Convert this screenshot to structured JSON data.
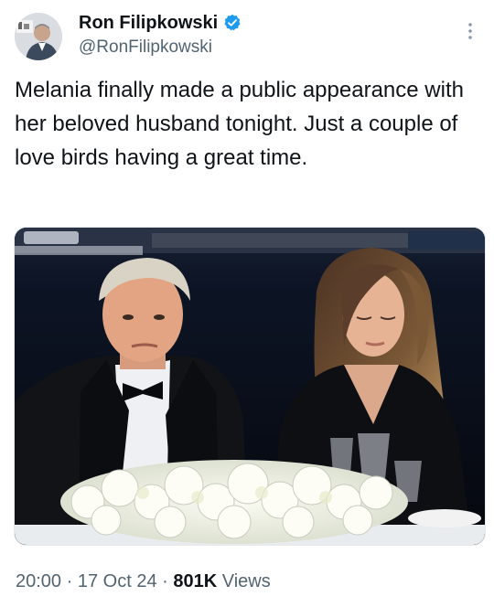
{
  "author": {
    "name": "Ron Filipkowski",
    "handle": "@RonFilipkowski",
    "verified": true,
    "verified_color": "#1d9bf0",
    "avatar_icon": "avatar-photo"
  },
  "tweet": {
    "text": "Melania finally made a public appearance with her beloved husband tonight. Just a couple of love birds having a great time.",
    "media": {
      "type": "photo",
      "icon": "photo"
    }
  },
  "meta": {
    "time": "20:00",
    "sep1": " · ",
    "date": "17 Oct 24",
    "sep2": " · ",
    "views_count": "801K",
    "views_label": " Views"
  },
  "icons": {
    "more": "more-vertical-icon",
    "verified": "verified-badge-icon"
  },
  "colors": {
    "text": "#0f1419",
    "secondary": "#536471",
    "accent": "#1d9bf0"
  }
}
